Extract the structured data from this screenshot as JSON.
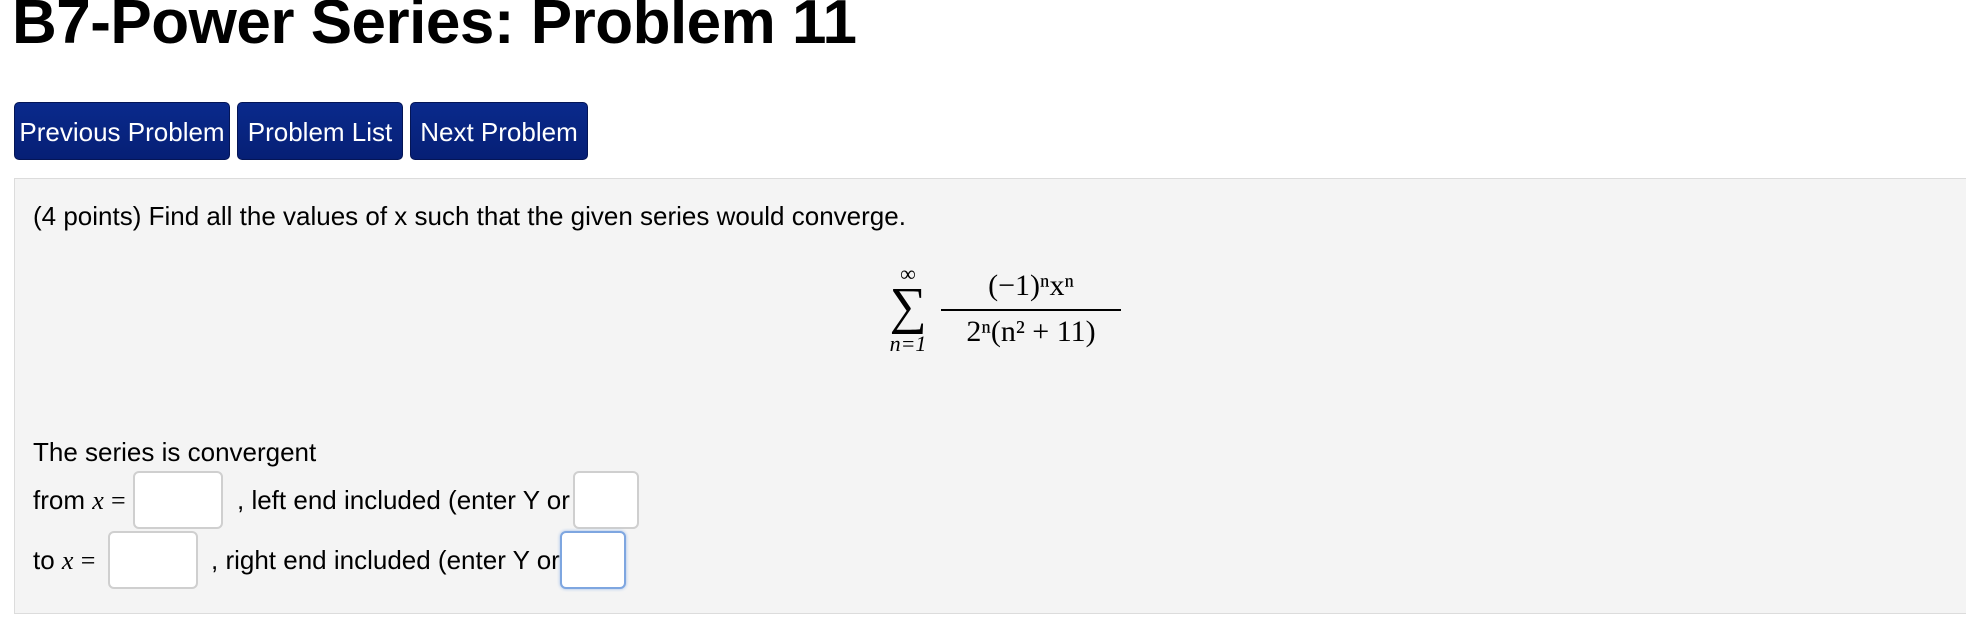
{
  "page": {
    "title": "B7-Power Series: Problem 11"
  },
  "nav": {
    "previous_label": "Previous Problem",
    "list_label": "Problem List",
    "next_label": "Next Problem"
  },
  "problem": {
    "prompt": "(4 points) Find all the values of x such that the given series would converge.",
    "formula": {
      "sum_upper": "∞",
      "sum_lower": "n=1",
      "numerator": "(−1)ⁿxⁿ",
      "denominator": "2ⁿ(n² + 11)"
    },
    "answer_intro": "The series is convergent",
    "from_label": "from",
    "to_label": "to",
    "x_var": "x",
    "equals": "=",
    "left_end_label": ", left end included (enter Y or N):",
    "right_end_label": ", right end included (enter Y or N):",
    "inputs": {
      "from_x_value": "",
      "left_included_value": "",
      "to_x_value": "",
      "right_included_value": ""
    }
  },
  "colors": {
    "button_bg": "#0a2a8c",
    "panel_bg": "#f4f4f4",
    "focus_border": "#7ea6e0"
  }
}
